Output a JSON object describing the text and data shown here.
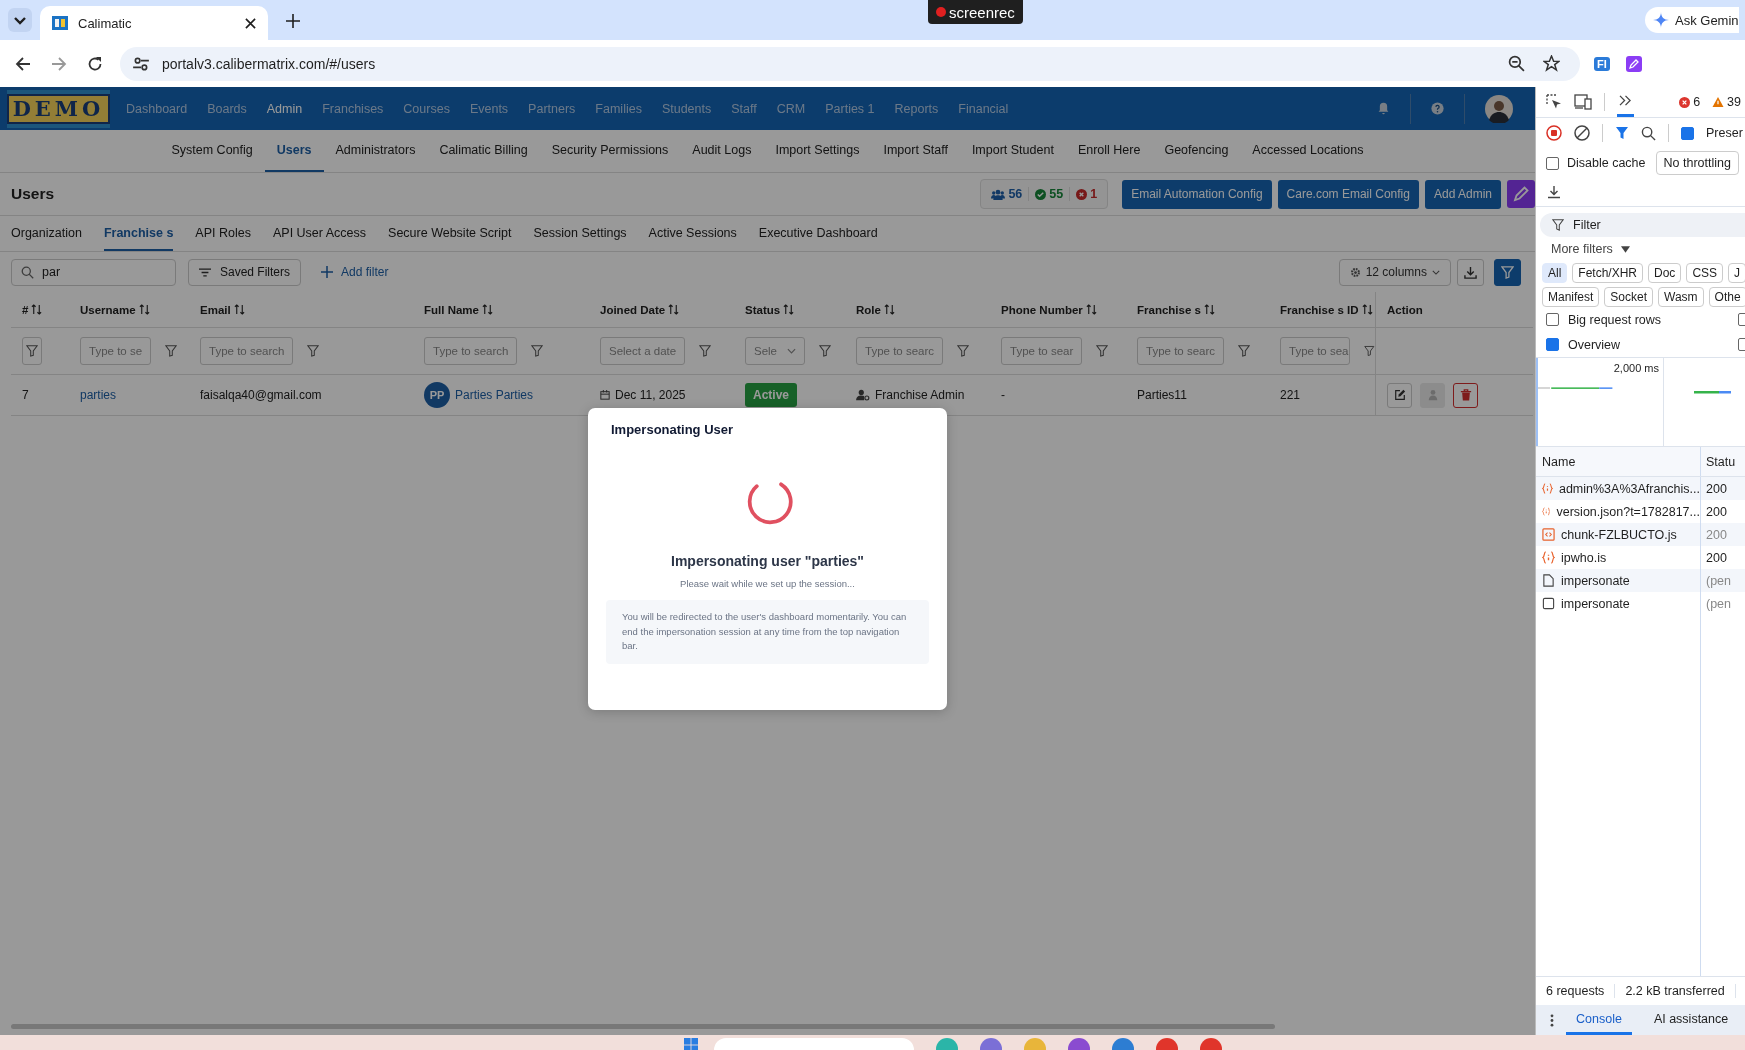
{
  "browser": {
    "tabs": [
      {
        "title": "Calimatic",
        "selected": true
      }
    ],
    "recorder": "screenrec",
    "gemini": "Ask Gemin",
    "url": "portalv3.calibermatrix.com/#/users",
    "extension_badge": "FI"
  },
  "app": {
    "logo": "DEMO",
    "nav": [
      {
        "label": "Dashboard",
        "selected": false
      },
      {
        "label": "Boards",
        "selected": false
      },
      {
        "label": "Admin",
        "selected": true
      },
      {
        "label": "Franchises",
        "selected": false
      },
      {
        "label": "Courses",
        "selected": false
      },
      {
        "label": "Events",
        "selected": false
      },
      {
        "label": "Partners",
        "selected": false
      },
      {
        "label": "Families",
        "selected": false
      },
      {
        "label": "Students",
        "selected": false
      },
      {
        "label": "Staff",
        "selected": false
      },
      {
        "label": "CRM",
        "selected": false
      },
      {
        "label": "Parties 1",
        "selected": false
      },
      {
        "label": "Reports",
        "selected": false
      },
      {
        "label": "Financial",
        "selected": false
      }
    ],
    "subnav": [
      {
        "label": "System Config",
        "selected": false
      },
      {
        "label": "Users",
        "selected": true
      },
      {
        "label": "Administrators",
        "selected": false
      },
      {
        "label": "Calimatic Billing",
        "selected": false
      },
      {
        "label": "Security Permissions",
        "selected": false
      },
      {
        "label": "Audit Logs",
        "selected": false
      },
      {
        "label": "Import Settings",
        "selected": false
      },
      {
        "label": "Import Staff",
        "selected": false
      },
      {
        "label": "Import Student",
        "selected": false
      },
      {
        "label": "Enroll Here",
        "selected": false
      },
      {
        "label": "Geofencing",
        "selected": false
      },
      {
        "label": "Accessed Locations",
        "selected": false
      }
    ],
    "page_title": "Users",
    "stats": [
      {
        "kind": "total",
        "value": "56"
      },
      {
        "kind": "active",
        "value": "55"
      },
      {
        "kind": "inactive",
        "value": "1"
      }
    ],
    "actions": [
      "Email Automation Config",
      "Care.com Email Config",
      "Add Admin"
    ],
    "tabs": [
      {
        "label": "Organization",
        "selected": false
      },
      {
        "label": "Franchise s",
        "selected": true
      },
      {
        "label": "API Roles",
        "selected": false
      },
      {
        "label": "API User Access",
        "selected": false
      },
      {
        "label": "Secure Website Script",
        "selected": false
      },
      {
        "label": "Session Settings",
        "selected": false
      },
      {
        "label": "Active Sessions",
        "selected": false
      },
      {
        "label": "Executive Dashboard",
        "selected": false
      }
    ],
    "search": {
      "value": "par"
    },
    "saved_filters": "Saved Filters",
    "add_filter": "Add filter",
    "columns_button": "12 columns",
    "table": {
      "columns": [
        {
          "label": "#",
          "sortable": true,
          "kind": "icon"
        },
        {
          "label": "Username",
          "sortable": true,
          "kind": "text",
          "placeholder": "Type to se"
        },
        {
          "label": "Email",
          "sortable": true,
          "kind": "text",
          "placeholder": "Type to search"
        },
        {
          "label": "Full Name",
          "sortable": true,
          "kind": "text",
          "placeholder": "Type to search"
        },
        {
          "label": "Joined Date",
          "sortable": true,
          "kind": "text",
          "placeholder": "Select a date"
        },
        {
          "label": "Status",
          "sortable": true,
          "kind": "select",
          "placeholder": "Sele"
        },
        {
          "label": "Role",
          "sortable": true,
          "kind": "text",
          "placeholder": "Type to searc"
        },
        {
          "label": "Phone Number",
          "sortable": true,
          "kind": "text",
          "placeholder": "Type to sear"
        },
        {
          "label": "Franchise s",
          "sortable": true,
          "kind": "text",
          "placeholder": "Type to searc"
        },
        {
          "label": "Franchise s ID",
          "sortable": true,
          "kind": "text",
          "placeholder": "Type to sea"
        },
        {
          "label": "Action",
          "sortable": false,
          "kind": "none"
        }
      ],
      "rows": [
        {
          "index": "7",
          "username": "parties",
          "email": "faisalqa40@gmail.com",
          "avatar": "PP",
          "full_name": "Parties Parties",
          "joined": "Dec 11, 2025",
          "status": {
            "label": "Active",
            "active": true
          },
          "role": "Franchise Admin",
          "phone": "-",
          "franchise": "Parties11",
          "franchise_id": "221",
          "actions": [
            {
              "kind": "edit",
              "disabled": false
            },
            {
              "kind": "impersonate",
              "disabled": true
            },
            {
              "kind": "delete",
              "disabled": false
            }
          ]
        }
      ]
    },
    "modal": {
      "title": "Impersonating User",
      "heading": "Impersonating user \"parties\"",
      "subtitle": "Please wait while we set up the session...",
      "note": "You will be redirected to the user's dashboard momentarily. You can end the impersonation session at any time from the top navigation bar."
    }
  },
  "devtools": {
    "errors": "6",
    "warnings": "39",
    "preserve": {
      "label": "Preser",
      "checked": true
    },
    "disable_cache": {
      "label": "Disable cache",
      "checked": false
    },
    "throttling": "No throttling",
    "filter_placeholder": "Filter",
    "more_filters": "More filters",
    "type_filters": [
      {
        "label": "All",
        "selected": true
      },
      {
        "label": "Fetch/XHR",
        "selected": false
      },
      {
        "label": "Doc",
        "selected": false
      },
      {
        "label": "CSS",
        "selected": false
      },
      {
        "label": "J",
        "selected": false
      },
      {
        "label": "Manifest",
        "selected": false
      },
      {
        "label": "Socket",
        "selected": false
      },
      {
        "label": "Wasm",
        "selected": false
      },
      {
        "label": "Othe",
        "selected": false
      }
    ],
    "options": [
      {
        "label": "Big request rows",
        "checked": false,
        "right_checked": false
      },
      {
        "label": "Overview",
        "checked": true,
        "right_checked": false
      }
    ],
    "timeline_label": "2,000 ms",
    "columns": [
      "Name",
      "Statu"
    ],
    "requests": [
      {
        "name": "admin%3A%3Afranchis...",
        "status": "200",
        "kind": "fetch",
        "dim": false
      },
      {
        "name": "version.json?t=1782817...",
        "status": "200",
        "kind": "fetch",
        "dim": false
      },
      {
        "name": "chunk-FZLBUCTO.js",
        "status": "200",
        "kind": "script",
        "dim": true
      },
      {
        "name": "ipwho.is",
        "status": "200",
        "kind": "fetch",
        "dim": false
      },
      {
        "name": "impersonate",
        "status": "(pen",
        "kind": "doc",
        "dim": true
      },
      {
        "name": "impersonate",
        "status": "(pen",
        "kind": "pending",
        "dim": true
      }
    ],
    "summary": [
      "6 requests",
      "2.2 kB transferred"
    ],
    "drawer_tabs": [
      {
        "label": "Console",
        "selected": true
      },
      {
        "label": "AI assistance",
        "selected": false
      }
    ]
  }
}
